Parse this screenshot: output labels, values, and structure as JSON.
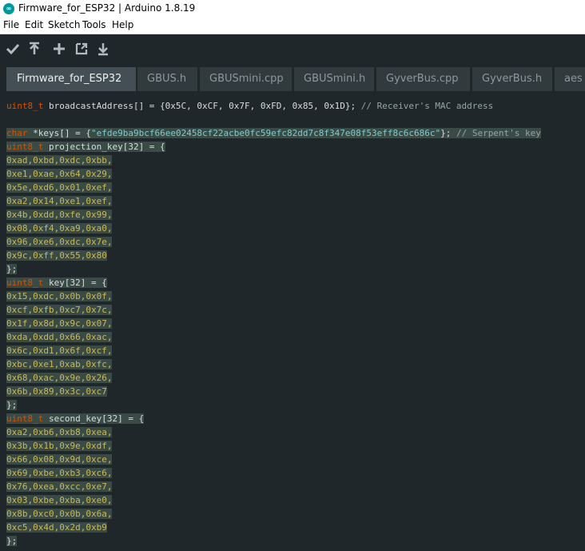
{
  "window": {
    "title": "Firmware_for_ESP32 | Arduino 1.8.19",
    "icon": "arduino-logo-icon"
  },
  "menu": [
    "File",
    "Edit",
    "Sketch",
    "Tools",
    "Help"
  ],
  "toolbar": [
    {
      "name": "verify-button",
      "icon": "checkmark-icon"
    },
    {
      "name": "upload-button",
      "icon": "upload-arrow-icon"
    },
    {
      "name": "new-button",
      "icon": "plus-icon"
    },
    {
      "name": "open-button",
      "icon": "open-icon"
    },
    {
      "name": "save-button",
      "icon": "download-arrow-icon"
    }
  ],
  "tabs": [
    "Firmware_for_ESP32",
    "GBUS.h",
    "GBUSmini.cpp",
    "GBUSmini.h",
    "GyverBus.cpp",
    "GyverBus.h",
    "aes"
  ],
  "active_tab": 0,
  "code": {
    "broadcast_line": "uint8_t broadcastAddress[] = {0x5C, 0xCF, 0x7F, 0xFD, 0x85, 0x1D}; // Receiver's MAC address",
    "keys_line": "char *keys[] = {\"efde9ba9bcf66ee02458cf22acbe0fc59efc82dd7c8f347e08f53eff8c6c686c\"}; // Serpent's key",
    "projection_decl": "uint8_t projection_key[32] = {",
    "projection_rows": [
      "0xad,0xbd,0xdc,0xbb,",
      "0xe1,0xae,0x64,0x29,",
      "0x5e,0xd6,0x01,0xef,",
      "0xa2,0x14,0xe1,0xef,",
      "0x4b,0xdd,0xfe,0x99,",
      "0x08,0xf4,0xa9,0xa0,",
      "0x96,0xe6,0xdc,0x7e,",
      "0x9c,0xff,0x55,0x80"
    ],
    "key_decl": "uint8_t key[32] = {",
    "key_rows": [
      "0x15,0xdc,0x0b,0x0f,",
      "0xcf,0xfb,0xc7,0x7c,",
      "0x1f,0x8d,0x9c,0x07,",
      "0xda,0xdd,0x66,0xac,",
      "0x6c,0xd1,0x6f,0xcf,",
      "0xbc,0xe1,0xab,0xfc,",
      "0x68,0xac,0x9e,0x26,",
      "0x6b,0x89,0x3c,0xc7"
    ],
    "second_decl": "uint8_t second_key[32] = {",
    "second_rows": [
      "0xa2,0xb6,0xb8,0xea,",
      "0x3b,0x1b,0x9e,0xdf,",
      "0x66,0x08,0x9d,0xce,",
      "0x69,0xbe,0xb3,0xc6,",
      "0x76,0xea,0xcc,0xe7,",
      "0x03,0xbe,0xba,0xe0,",
      "0x8b,0xc0,0x0b,0x6a,",
      "0xc5,0x4d,0x2d,0xb9"
    ],
    "close": "};"
  },
  "colors": {
    "editor_bg": "#1f272a",
    "tab_active": "#434f54",
    "tab_inactive": "#313b3e",
    "type": "#d35400",
    "highlight": "#3a4a45"
  }
}
